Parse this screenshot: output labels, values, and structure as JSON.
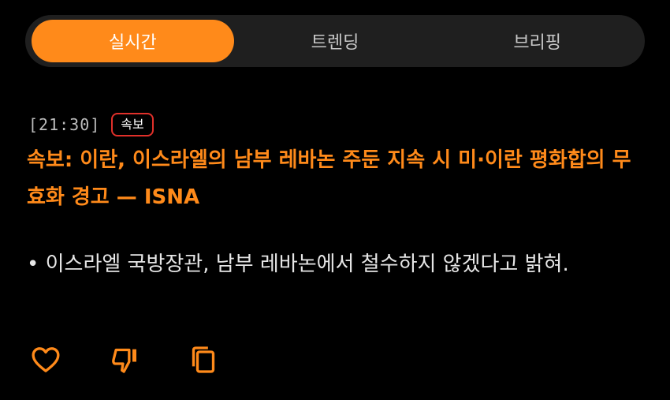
{
  "tabs": [
    {
      "label": "실시간",
      "active": true
    },
    {
      "label": "트렌딩",
      "active": false
    },
    {
      "label": "브리핑",
      "active": false
    }
  ],
  "article": {
    "time": "[21:30]",
    "badge": "속보",
    "headline": "속보: 이란, 이스라엘의 남부 레바논 주둔 지속 시 미·이란 평화합의 무효화 경고 — ISNA",
    "bullet": "• 이스라엘 국방장관, 남부 레바논에서 철수하지 않겠다고 밝혀."
  },
  "actions": {
    "icons": [
      "heart-icon",
      "thumbs-down-icon",
      "copy-icon"
    ]
  },
  "colors": {
    "accent": "#ff8a1a",
    "badge_border": "#e0302a",
    "background": "#000000",
    "tabbar_bg": "#1f1f1f"
  }
}
